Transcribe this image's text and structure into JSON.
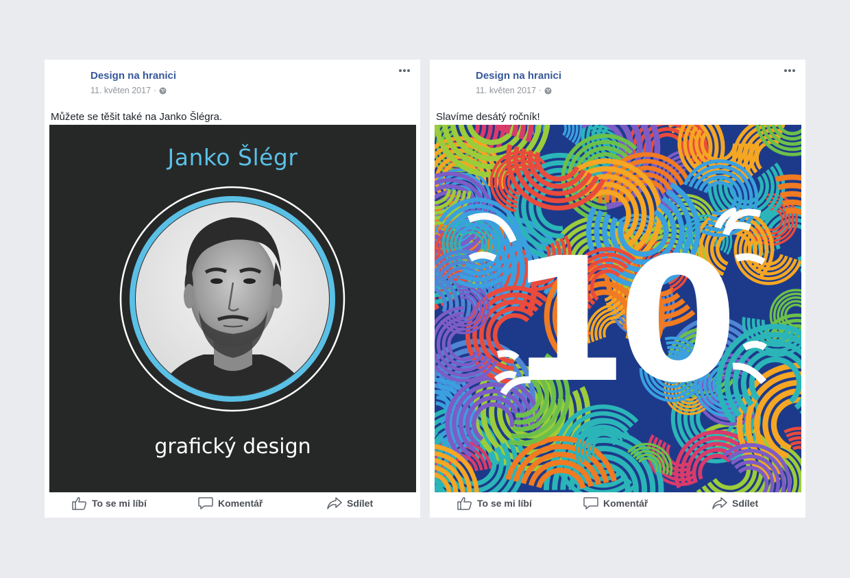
{
  "posts": [
    {
      "page_name": "Design na hranici",
      "date": "11. květen 2017",
      "separator": "·",
      "text": "Můžete se těšit také na Janko Šlégra.",
      "image_title": "Janko Šlégr",
      "image_subtitle": "grafický design",
      "actions": {
        "like": "To se mi líbí",
        "comment": "Komentář",
        "share": "Sdílet"
      }
    },
    {
      "page_name": "Design na hranici",
      "date": "11. květen 2017",
      "separator": "·",
      "text": "Slavíme desátý ročník!",
      "image_number": "10",
      "actions": {
        "like": "To se mi líbí",
        "comment": "Komentář",
        "share": "Sdílet"
      }
    }
  ],
  "icons": {
    "privacy": "globe-icon",
    "options": "more-options-icon",
    "like": "thumbs-up-icon",
    "comment": "speech-bubble-icon",
    "share": "share-arrow-icon"
  },
  "colors": {
    "link": "#365899",
    "accent_blue": "#5bc0e6",
    "dark_bg": "#262827"
  }
}
